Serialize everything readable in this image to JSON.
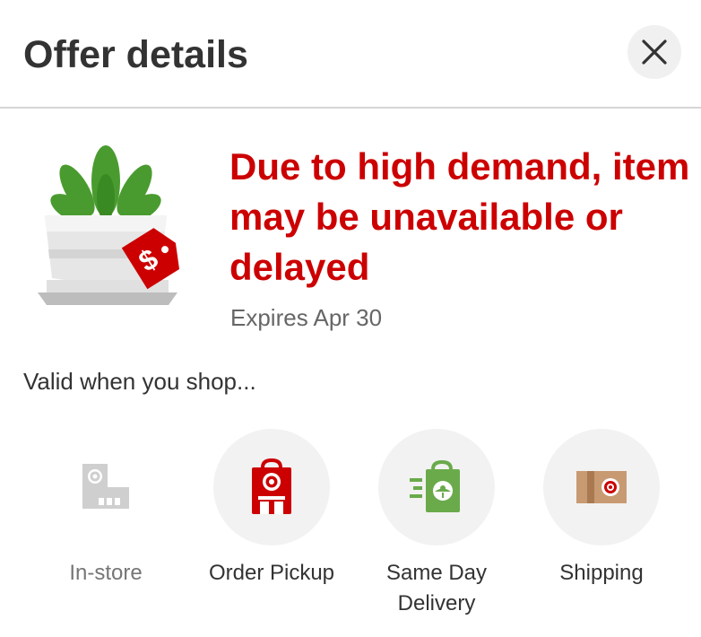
{
  "header": {
    "title": "Offer details",
    "close_icon": "close-icon"
  },
  "offer": {
    "image_icon": "plant-pot-price-tag-illustration",
    "headline": "Due to high demand, item may be unavailable or delayed",
    "expires": "Expires Apr 30"
  },
  "valid_label": "Valid when you shop...",
  "options": [
    {
      "label": "In-store",
      "icon": "store-building-icon",
      "enabled": false
    },
    {
      "label": "Order Pickup",
      "icon": "pickup-bag-icon",
      "enabled": true
    },
    {
      "label": "Same Day Delivery",
      "icon": "delivery-bag-icon",
      "enabled": true
    },
    {
      "label": "Shipping",
      "icon": "shipping-box-icon",
      "enabled": true
    }
  ],
  "colors": {
    "brand_red": "#cc0000",
    "title_text": "#333333",
    "muted_text": "#666666",
    "disabled_text": "#767676",
    "circle_bg": "#f2f2f2",
    "delivery_green": "#6aaa4b",
    "box_tan": "#c89a72"
  }
}
